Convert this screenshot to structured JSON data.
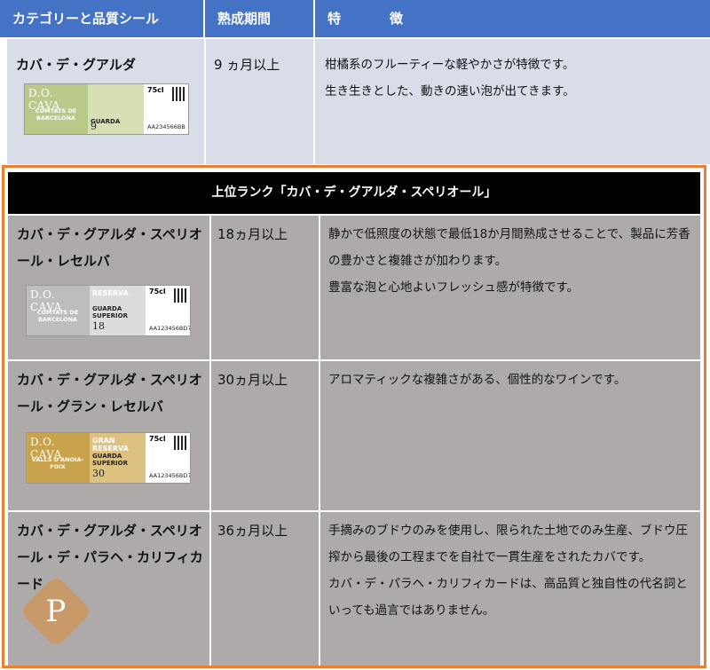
{
  "header": {
    "col_category": "カテゴリーと品質シール",
    "col_aging": "熟成期間",
    "col_features": "特　徴"
  },
  "row_guarda": {
    "name": "カバ・デ・グアルダ",
    "aging": "9 ヵ月以上",
    "features": [
      "柑橘系のフルーティーな軽やかさが特徴です。",
      "生き生きとした、動きの速い泡が出てきます。"
    ],
    "seal": {
      "do": "D.O. CAVA",
      "region": "COMTATS DE BARCELONA",
      "category": "GUARDA",
      "months": "9",
      "volume": "75cl",
      "lot": "AA234566BB",
      "color": "#b8c98a"
    }
  },
  "superior": {
    "title": "上位ランク「カバ・デ・グアルダ・スペリオール」",
    "rows": [
      {
        "name": "カバ・デ・グアルダ・スペリオール・レセルバ",
        "aging": "18ヵ月以上",
        "features": [
          "静かで低照度の状態で最低18か月間熟成させることで、製品に芳香の豊かさと複雑さが加わります。",
          "豊富な泡と心地よいフレッシュ感が特徴です。"
        ],
        "seal": {
          "do": "D.O. CAVA",
          "region": "COMTATS DE BARCELONA",
          "category": "RESERVA",
          "sub": "GUARDA SUPERIOR",
          "months": "18",
          "volume": "75cl",
          "lot": "AA123456BD7",
          "color": "#c8c8c8"
        }
      },
      {
        "name": "カバ・デ・グアルダ・スペリオール・グラン・レセルバ",
        "aging": "30ヵ月以上",
        "features": [
          "アロマティックな複雑さがある、個性的なワインです。"
        ],
        "seal": {
          "do": "D.O. CAVA",
          "region": "VALLS D'ANOIA-FOIX",
          "category": "GRAN RESERVA",
          "sub": "GUARDA SUPERIOR",
          "months": "30",
          "volume": "75cl",
          "lot": "AA123456BD7",
          "color": "#c9a24c"
        }
      },
      {
        "name": "カバ・デ・グアルダ・スペリオール・デ・パラヘ・カリフィカード",
        "aging": "36ヵ月以上",
        "features": [
          "手摘みのブドウのみを使用し、限られた土地でのみ生産、ブドウ圧搾から最後の工程までを自社で一貫生産をされたカバです。",
          "カバ・デ・パラヘ・カリフィカードは、高品質と独自性の代名詞といっても過言ではありません。"
        ],
        "medal_letter": "P"
      }
    ]
  }
}
